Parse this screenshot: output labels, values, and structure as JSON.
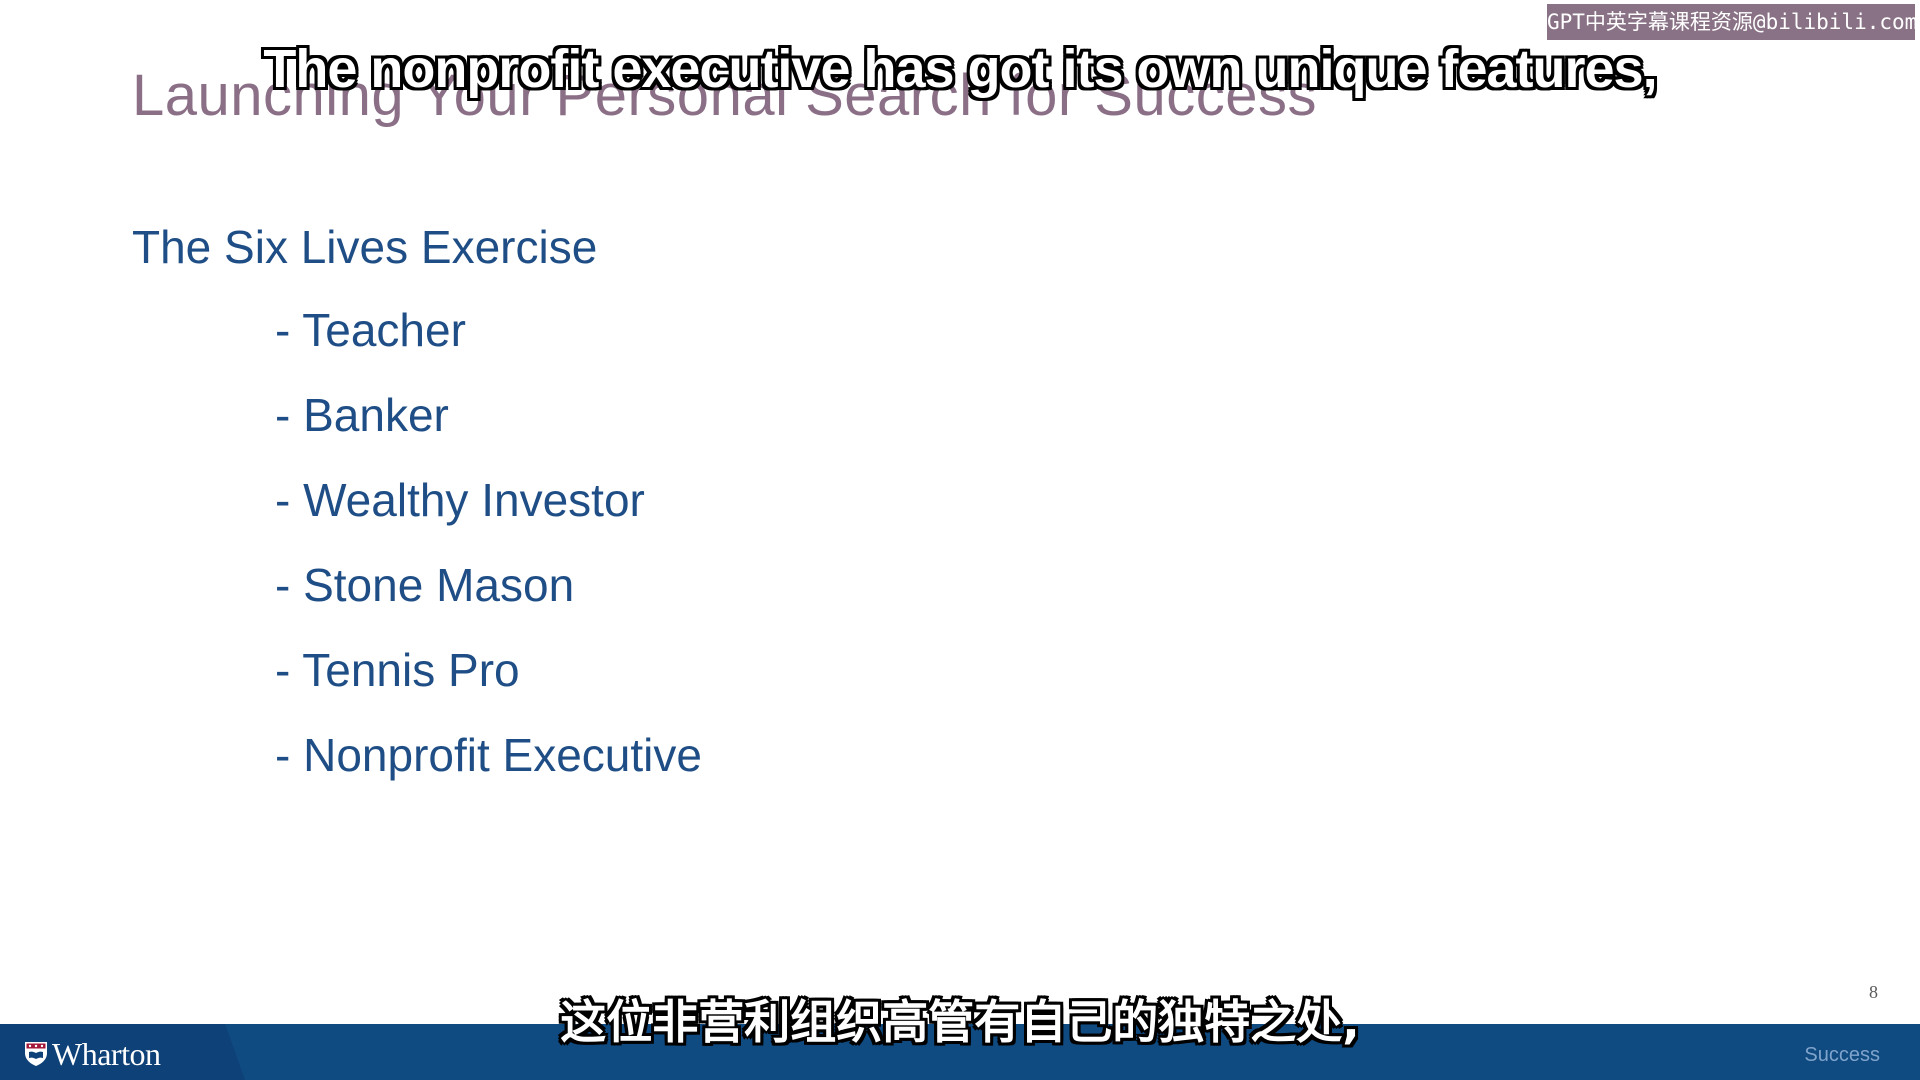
{
  "slide": {
    "title": "Launching Your Personal Search for Success",
    "heading": "The Six Lives Exercise",
    "items": [
      "- Teacher",
      "- Banker",
      "- Wealthy Investor",
      "- Stone Mason",
      "- Tennis Pro",
      "- Nonprofit Executive"
    ],
    "page_number": "8"
  },
  "footer": {
    "logo_text": "Wharton",
    "label": "Success"
  },
  "subtitles": {
    "english": "The nonprofit executive has got its own unique features,",
    "chinese": "这位非营利组织高管有自己的独特之处,"
  },
  "watermark": "GPT中英字幕课程资源@bilibili.com",
  "colors": {
    "title": "#8a6f86",
    "body_text": "#1f4e86",
    "footer_bar": "#0f4a80",
    "footer_label": "#7fa4cc",
    "watermark_bg": "#8a7286"
  },
  "icons": {
    "logo": "shield-icon"
  }
}
